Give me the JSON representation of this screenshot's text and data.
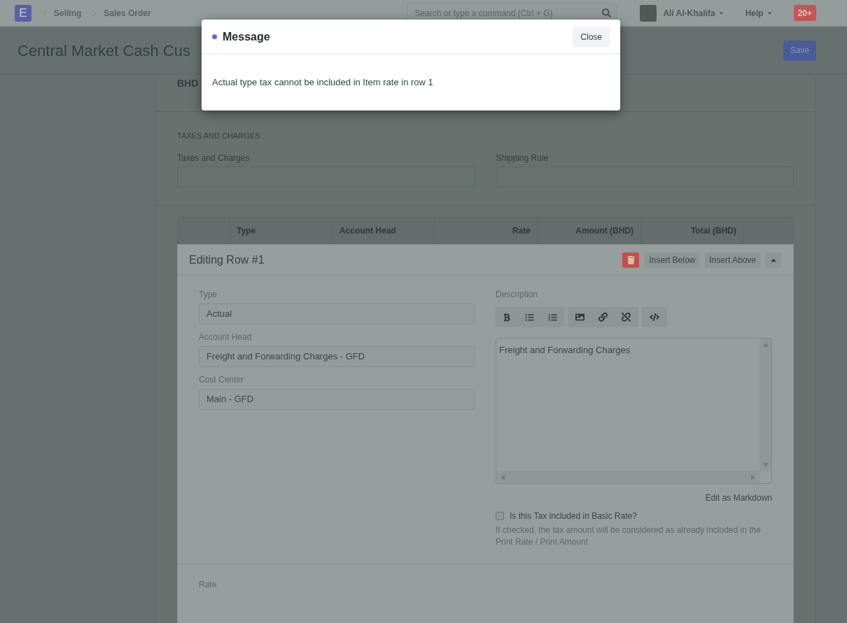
{
  "navbar": {
    "logo": "E",
    "breadcrumbs": [
      "Selling",
      "Sales Order"
    ],
    "search": {
      "placeholder": "Search or type a command (Ctrl + G)"
    },
    "user": {
      "name": "Ali Al-Khalifa"
    },
    "help": "Help",
    "notifications": "20+"
  },
  "page_header": {
    "title": "Central Market Cash Cus",
    "save_button": "Save"
  },
  "form": {
    "currency_total": "BHD",
    "taxes_section": {
      "heading": "TAXES AND CHARGES",
      "fields": [
        {
          "label": "Taxes and Charges"
        },
        {
          "label": "Shipping Rule"
        }
      ]
    },
    "table": {
      "columns": [
        {
          "label": "Type",
          "kind": "text"
        },
        {
          "label": "Account Head",
          "kind": "text"
        },
        {
          "label": "Rate",
          "kind": "number"
        },
        {
          "label": "Amount (BHD)",
          "kind": "number"
        },
        {
          "label": "Total (BHD)",
          "kind": "number"
        }
      ]
    },
    "editing_row": {
      "title": "Editing Row #1",
      "buttons": [
        "Insert Below",
        "Insert Above"
      ],
      "fields": [
        {
          "label": "Type",
          "value": "Actual"
        },
        {
          "label": "Account Head",
          "value": "Freight and Forwarding Charges - GFD"
        },
        {
          "label": "Cost Center",
          "value": "Main - GFD"
        }
      ],
      "description": {
        "label": "Description",
        "value": "Freight and Forwarding Charges",
        "edit_link": "Edit as Markdown"
      },
      "tax_included": {
        "label": "Is this Tax included in Basic Rate?",
        "checked": false,
        "help": "If checked, the tax amount will be considered as already included in the Print Rate / Print Amount"
      },
      "rate_label": "Rate"
    }
  },
  "dialog": {
    "title": "Message",
    "close_button": "Close",
    "message": "Actual type tax cannot be included in Item rate in row 1"
  }
}
